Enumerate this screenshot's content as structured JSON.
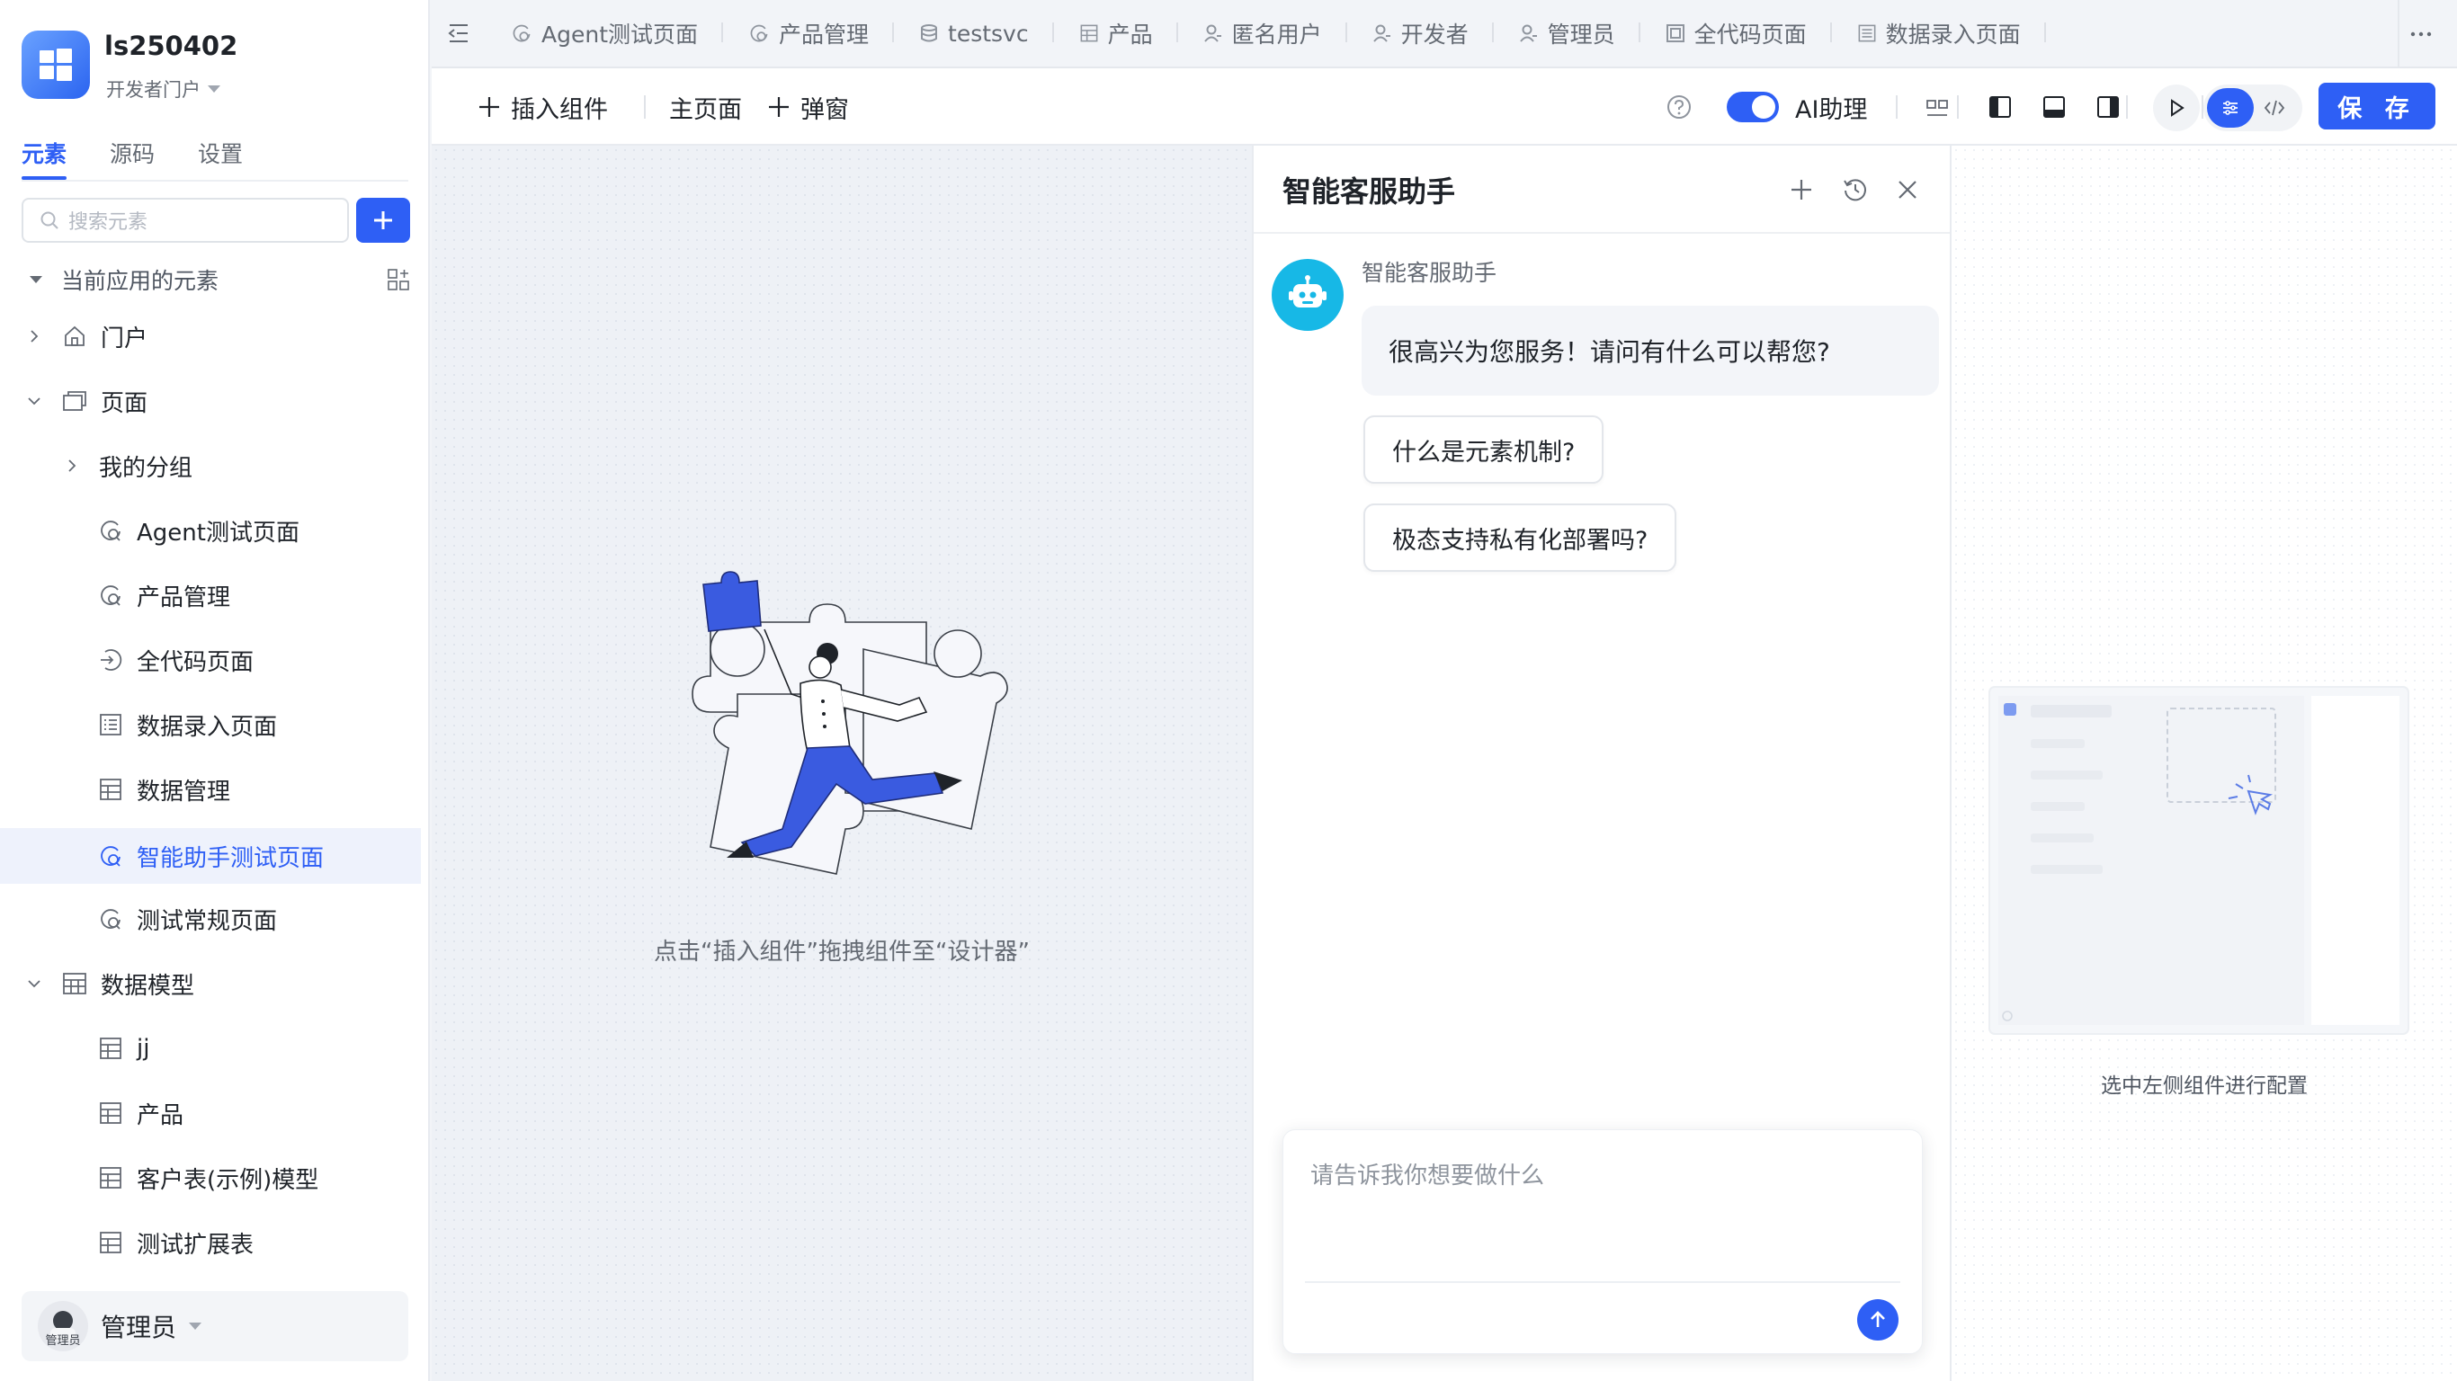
{
  "app": {
    "name": "ls250402",
    "subtitle": "开发者门户"
  },
  "sidebar": {
    "tabs": [
      "元素",
      "源码",
      "设置"
    ],
    "active_tab": "元素",
    "search_placeholder": "搜索元素",
    "section_title": "当前应用的元素",
    "tree": [
      {
        "label": "门户",
        "icon": "home-icon",
        "level": 0,
        "expand": "collapsed"
      },
      {
        "label": "页面",
        "icon": "pages-icon",
        "level": 0,
        "expand": "expanded"
      },
      {
        "label": "我的分组",
        "icon": "",
        "level": 1,
        "expand": "collapsed"
      },
      {
        "label": "Agent测试页面",
        "icon": "page-icon",
        "level": 2
      },
      {
        "label": "产品管理",
        "icon": "page-icon",
        "level": 2
      },
      {
        "label": "全代码页面",
        "icon": "code-page-icon",
        "level": 2
      },
      {
        "label": "数据录入页面",
        "icon": "form-icon",
        "level": 2
      },
      {
        "label": "数据管理",
        "icon": "table-icon",
        "level": 2
      },
      {
        "label": "智能助手测试页面",
        "icon": "page-icon",
        "level": 2,
        "selected": true
      },
      {
        "label": "测试常规页面",
        "icon": "page-icon",
        "level": 2
      },
      {
        "label": "数据模型",
        "icon": "model-icon",
        "level": 0,
        "expand": "expanded"
      },
      {
        "label": "jj",
        "icon": "table-icon",
        "level": 2
      },
      {
        "label": "产品",
        "icon": "table-icon",
        "level": 2
      },
      {
        "label": "客户表(示例)模型",
        "icon": "table-icon",
        "level": 2
      },
      {
        "label": "测试扩展表",
        "icon": "table-icon",
        "level": 2
      }
    ],
    "user": {
      "name": "管理员",
      "avatar_label": "管理员"
    }
  },
  "tabs": [
    {
      "label": "Agent测试页面",
      "icon": "page-icon"
    },
    {
      "label": "产品管理",
      "icon": "page-icon"
    },
    {
      "label": "testsvc",
      "icon": "service-icon"
    },
    {
      "label": "产品",
      "icon": "table-icon"
    },
    {
      "label": "匿名用户",
      "icon": "user-icon"
    },
    {
      "label": "开发者",
      "icon": "user-icon"
    },
    {
      "label": "管理员",
      "icon": "user-icon"
    },
    {
      "label": "全代码页面",
      "icon": "code-page-icon"
    },
    {
      "label": "数据录入页面",
      "icon": "form-icon"
    }
  ],
  "toolbar": {
    "insert_label": "插入组件",
    "main_page_label": "主页面",
    "popup_label": "弹窗",
    "ai_label": "AI助理",
    "ai_enabled": true,
    "save_label": "保 存"
  },
  "canvas": {
    "hint": "点击“插入组件”拖拽组件至“设计器”"
  },
  "chat": {
    "title": "智能客服助手",
    "bot_name": "智能客服助手",
    "greeting": "很高兴为您服务！请问有什么可以帮您?",
    "suggestions": [
      "什么是元素机制?",
      "极态支持私有化部署吗?"
    ],
    "input_placeholder": "请告诉我你想要做什么"
  },
  "config": {
    "hint": "选中左侧组件进行配置"
  },
  "colors": {
    "accent": "#2e5ff5",
    "bot": "#17b8e6",
    "illustration_blue": "#3a5be0"
  }
}
